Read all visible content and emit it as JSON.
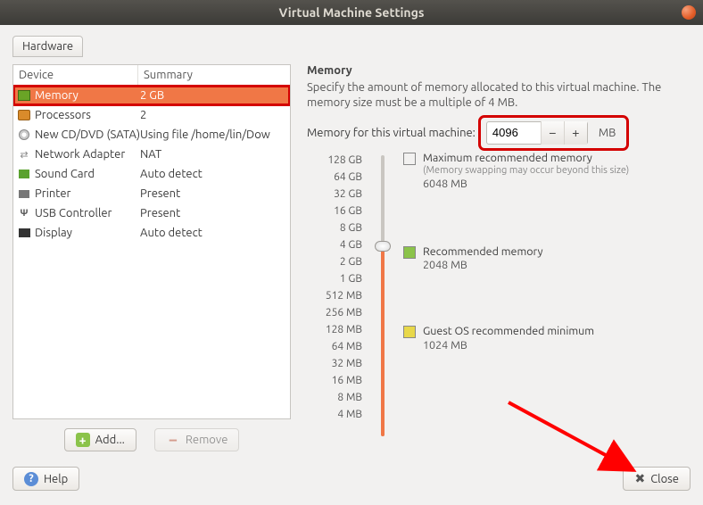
{
  "window": {
    "title": "Virtual Machine Settings"
  },
  "tabs": {
    "hardware": "Hardware"
  },
  "device_table": {
    "col_device": "Device",
    "col_summary": "Summary",
    "rows": [
      {
        "icon": "memory-icon",
        "label": "Memory",
        "summary": "2 GB",
        "selected": true
      },
      {
        "icon": "cpu-icon",
        "label": "Processors",
        "summary": "2"
      },
      {
        "icon": "disc-icon",
        "label": "New CD/DVD (SATA)",
        "summary": "Using file /home/lin/Dow"
      },
      {
        "icon": "network-icon",
        "label": "Network Adapter",
        "summary": "NAT"
      },
      {
        "icon": "sound-icon",
        "label": "Sound Card",
        "summary": "Auto detect"
      },
      {
        "icon": "printer-icon",
        "label": "Printer",
        "summary": "Present"
      },
      {
        "icon": "usb-icon",
        "label": "USB Controller",
        "summary": "Present"
      },
      {
        "icon": "display-icon",
        "label": "Display",
        "summary": "Auto detect"
      }
    ]
  },
  "left_buttons": {
    "add": "Add...",
    "remove": "Remove"
  },
  "memory_panel": {
    "heading": "Memory",
    "description": "Specify the amount of memory allocated to this virtual machine. The memory size must be a multiple of 4 MB.",
    "field_label": "Memory for this virtual machine:",
    "value": "4096",
    "unit": "MB",
    "ticks": [
      "128 GB",
      "64 GB",
      "32 GB",
      "16 GB",
      "8 GB",
      "4 GB",
      "2 GB",
      "1 GB",
      "512 MB",
      "256 MB",
      "128 MB",
      "64 MB",
      "32 MB",
      "16 MB",
      "8 MB",
      "4 MB"
    ],
    "legend": {
      "max": {
        "title": "Maximum recommended memory",
        "sub": "(Memory swapping may occur beyond this size)",
        "value": "6048 MB",
        "color": "#5b8dd6"
      },
      "rec": {
        "title": "Recommended memory",
        "value": "2048 MB",
        "color": "#8bc34a"
      },
      "min": {
        "title": "Guest OS recommended minimum",
        "value": "1024 MB",
        "color": "#e8d84a"
      }
    }
  },
  "footer": {
    "help": "Help",
    "close": "Close"
  }
}
